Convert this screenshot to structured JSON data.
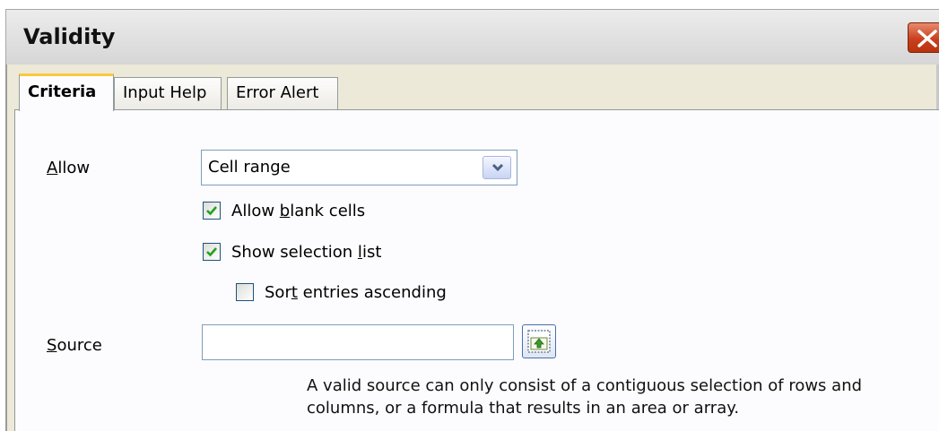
{
  "window": {
    "title": "Validity"
  },
  "tabs": [
    {
      "label": "Criteria",
      "active": true
    },
    {
      "label": "Input Help",
      "active": false
    },
    {
      "label": "Error Alert",
      "active": false
    }
  ],
  "criteria": {
    "allow": {
      "label_mnemonic": "A",
      "label_rest": "llow",
      "selected_value": "Cell range"
    },
    "allow_blank": {
      "label_pre": "Allow ",
      "label_mnemonic": "b",
      "label_post": "lank cells",
      "checked": true
    },
    "show_list": {
      "label_pre": "Show selection ",
      "label_mnemonic": "l",
      "label_post": "ist",
      "checked": true
    },
    "sort_entries": {
      "label_pre": "Sor",
      "label_mnemonic": "t",
      "label_post": " entries ascending",
      "checked": false
    },
    "source": {
      "label_mnemonic": "S",
      "label_rest": "ource",
      "value": "",
      "help_text": "A valid source can only consist of a contiguous selection of rows and columns, or a formula that results in an area or array."
    }
  },
  "icons": {
    "close": "close-x-icon",
    "dropdown": "chevron-down-icon",
    "shrink": "shrink-arrow-icon",
    "checkmark": "checkmark-icon"
  },
  "colors": {
    "dialog_bg": "#ece9d8",
    "panel_bg": "#fcfcfe",
    "active_tab_accent": "#ffc83c",
    "close_button": "#c9401e",
    "checkmark": "#21a121"
  }
}
